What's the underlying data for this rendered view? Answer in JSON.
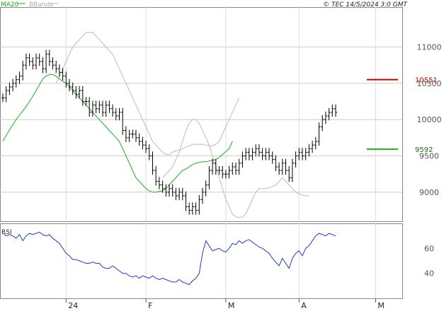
{
  "legend": {
    "ma_label": "MA20",
    "bb_label": "BBands",
    "ma_color": "#22aa22",
    "bb_color": "#bbbbbb"
  },
  "copyright": "© TEC 14/5/2024 3:0 GMT",
  "colors": {
    "price": "#000000",
    "rsi": "#1f3fbf",
    "resistance": "#cc0000",
    "support": "#22aa22",
    "grid": "#cccccc"
  },
  "chart_data": [
    {
      "type": "line",
      "title": "",
      "ylim": [
        8600,
        11550
      ],
      "y_ticks": [
        9000,
        9500,
        10000,
        10500,
        11000
      ],
      "y_tick_labels": [
        "9000",
        "9500",
        "10000",
        "10500",
        "11000"
      ],
      "x_labels": [
        "24",
        "F",
        "M",
        "A",
        "M"
      ],
      "x_label_index": [
        19,
        43,
        67,
        89,
        112
      ],
      "levels": [
        {
          "name": "resistance",
          "value": 10551,
          "label": "10551"
        },
        {
          "name": "ma20-last",
          "value": 9592,
          "label": "9592"
        }
      ],
      "series": [
        {
          "name": "price-close",
          "values": [
            10300,
            10400,
            10450,
            10500,
            10550,
            10600,
            10750,
            10850,
            10800,
            10750,
            10850,
            10800,
            10700,
            10900,
            10800,
            10750,
            10700,
            10650,
            10600,
            10500,
            10450,
            10400,
            10350,
            10400,
            10250,
            10250,
            10100,
            10200,
            10150,
            10200,
            10100,
            10200,
            10150,
            10100,
            10050,
            10100,
            9850,
            9750,
            9800,
            9800,
            9750,
            9700,
            9650,
            9600,
            9500,
            9300,
            9150,
            9100,
            9050,
            9000,
            9050,
            9000,
            8950,
            9000,
            8950,
            8800,
            8750,
            8800,
            8750,
            8900,
            9000,
            9100,
            9300,
            9400,
            9300,
            9300,
            9250,
            9250,
            9300,
            9350,
            9300,
            9400,
            9500,
            9550,
            9500,
            9550,
            9600,
            9550,
            9500,
            9550,
            9500,
            9450,
            9350,
            9300,
            9400,
            9300,
            9200,
            9400,
            9500,
            9550,
            9500,
            9550,
            9600,
            9650,
            9700,
            9900,
            10000,
            10050,
            10100,
            10150,
            10100
          ]
        },
        {
          "name": "ma20",
          "values": [
            9700,
            9780,
            9860,
            9930,
            10000,
            10060,
            10120,
            10180,
            10250,
            10320,
            10400,
            10480,
            10560,
            10600,
            10620,
            10620,
            10600,
            10560,
            10530,
            10500,
            10450,
            10400,
            10350,
            10300,
            10250,
            10200,
            10150,
            10100,
            10050,
            10000,
            9950,
            9900,
            9850,
            9800,
            9750,
            9700,
            9600,
            9500,
            9400,
            9300,
            9200,
            9150,
            9100,
            9050,
            9020,
            9000,
            9000,
            9010,
            9020,
            9050,
            9100,
            9150,
            9200,
            9250,
            9300,
            9320,
            9350,
            9380,
            9400,
            9410,
            9420,
            9420,
            9430,
            9440,
            9450,
            9480,
            9520,
            9560,
            9600,
            9700
          ]
        },
        {
          "name": "bb-upper",
          "values": [
            10500,
            10600,
            10700,
            10800,
            10900,
            11000,
            11050,
            11100,
            11150,
            11200,
            11200,
            11200,
            11150,
            11100,
            11050,
            11000,
            10950,
            10900,
            10800,
            10700,
            10600,
            10500,
            10400,
            10300,
            10200,
            10100,
            10000,
            9900,
            9800,
            9700,
            9650,
            9600,
            9550,
            9520,
            9520,
            9550,
            9570,
            9580,
            9600,
            9620,
            9640,
            9660,
            9660,
            9660,
            9660,
            9650,
            9640,
            9640,
            9660,
            9700,
            9800,
            9900,
            10000,
            10100,
            10200,
            10300
          ]
        },
        {
          "name": "bb-lower",
          "values": [
            9200,
            9250,
            9300,
            9350,
            9450,
            9550,
            9700,
            9850,
            9950,
            10000,
            10000,
            9950,
            9850,
            9750,
            9650,
            9500,
            9350,
            9200,
            9050,
            8900,
            8800,
            8700,
            8660,
            8650,
            8660,
            8700,
            8800,
            8900,
            9000,
            9050,
            9050,
            9050,
            9060,
            9080,
            9100,
            9150,
            9200,
            9150,
            9100,
            9050,
            9000,
            8980,
            8960,
            8950,
            8950
          ]
        }
      ]
    },
    {
      "type": "line",
      "title": "",
      "ylim": [
        20,
        80
      ],
      "y_ticks": [
        40,
        60
      ],
      "y_tick_labels": [
        "40",
        "60"
      ],
      "series": [
        {
          "name": "RSI",
          "values": [
            72,
            70,
            71,
            70,
            68,
            71,
            66,
            70,
            72,
            71,
            72,
            73,
            71,
            70,
            71,
            68,
            66,
            64,
            60,
            56,
            54,
            51,
            51,
            50,
            49,
            48,
            48,
            49,
            48,
            48,
            45,
            44,
            44,
            46,
            44,
            42,
            40,
            40,
            38,
            37,
            38,
            36,
            38,
            37,
            36,
            38,
            36,
            35,
            36,
            35,
            34,
            33,
            33,
            35,
            33,
            32,
            31,
            34,
            36,
            40,
            56,
            66,
            62,
            58,
            59,
            60,
            58,
            57,
            60,
            64,
            63,
            66,
            64,
            66,
            67,
            65,
            63,
            61,
            60,
            58,
            56,
            52,
            49,
            46,
            52,
            48,
            44,
            52,
            56,
            58,
            54,
            60,
            62,
            66,
            70,
            72,
            71,
            70,
            72,
            71,
            70
          ]
        }
      ],
      "label": "RSI"
    }
  ]
}
